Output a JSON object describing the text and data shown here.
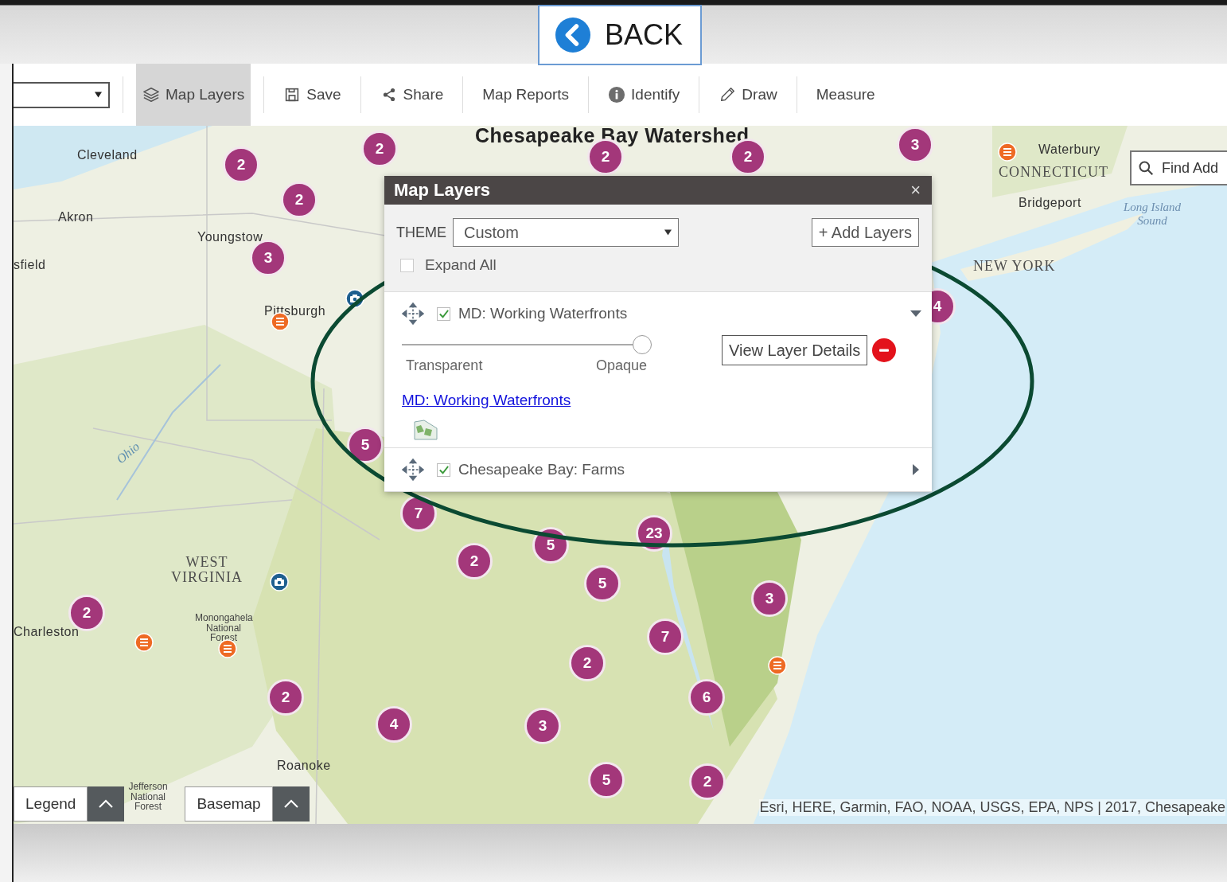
{
  "back_button": {
    "label": "BACK"
  },
  "toolbar": {
    "items": [
      {
        "label": "Map Layers",
        "kind": "layers",
        "selected": true
      },
      {
        "label": "Save",
        "kind": "save",
        "selected": false
      },
      {
        "label": "Share",
        "kind": "share",
        "selected": false
      },
      {
        "label": "Map Reports",
        "kind": "plain",
        "selected": false
      },
      {
        "label": "Identify",
        "kind": "info",
        "selected": false
      },
      {
        "label": "Draw",
        "kind": "pencil",
        "selected": false
      },
      {
        "label": "Measure",
        "kind": "plain",
        "selected": false
      }
    ]
  },
  "map": {
    "title": "Chesapeake Bay Watershed",
    "places": [
      {
        "name": "Cleveland",
        "kind": "city"
      },
      {
        "name": "Akron",
        "kind": "city"
      },
      {
        "name": "Youngstow",
        "kind": "city"
      },
      {
        "name": "sfield",
        "kind": "city"
      },
      {
        "name": "Pittsburgh",
        "kind": "city"
      },
      {
        "name": "Ohio",
        "kind": "river"
      },
      {
        "name": "WEST VIRGINIA",
        "kind": "state"
      },
      {
        "name": "Charleston",
        "kind": "city"
      },
      {
        "name": "Monongahela National Forest",
        "kind": "forest"
      },
      {
        "name": "Roanoke",
        "kind": "city"
      },
      {
        "name": "Jefferson National Forest",
        "kind": "forest"
      },
      {
        "name": "Waterbury",
        "kind": "city"
      },
      {
        "name": "CONNECTICUT",
        "kind": "state"
      },
      {
        "name": "Bridgeport",
        "kind": "city"
      },
      {
        "name": "Long Island Sound",
        "kind": "water"
      },
      {
        "name": "NEW YORK",
        "kind": "state"
      }
    ],
    "clusters": [
      "2",
      "2",
      "2",
      "3",
      "2",
      "2",
      "3",
      "4",
      "5",
      "7",
      "5",
      "23",
      "2",
      "5",
      "3",
      "2",
      "7",
      "2",
      "6",
      "2",
      "4",
      "3",
      "5",
      "2"
    ],
    "search": {
      "placeholder": "Find Add"
    },
    "bottom_buttons": [
      {
        "label": "Legend"
      },
      {
        "label": "Basemap"
      }
    ],
    "attribution": "Esri, HERE, Garmin, FAO, NOAA, USGS, EPA, NPS | 2017, Chesapeake"
  },
  "layers_panel": {
    "title": "Map Layers",
    "close": "×",
    "theme_label": "THEME",
    "theme_value": "Custom",
    "add_button": "+ Add Layers",
    "expand_all": {
      "label": "Expand All",
      "checked": false
    },
    "layers": [
      {
        "name": "MD: Working Waterfronts",
        "checked": true,
        "expanded": true,
        "opacity": {
          "level": 1,
          "min_label": "Transparent",
          "max_label": "Opaque"
        },
        "details_button": "View Layer Details",
        "link": "MD: Working Waterfronts"
      },
      {
        "name": "Chesapeake Bay: Farms",
        "checked": true,
        "expanded": false
      }
    ]
  }
}
